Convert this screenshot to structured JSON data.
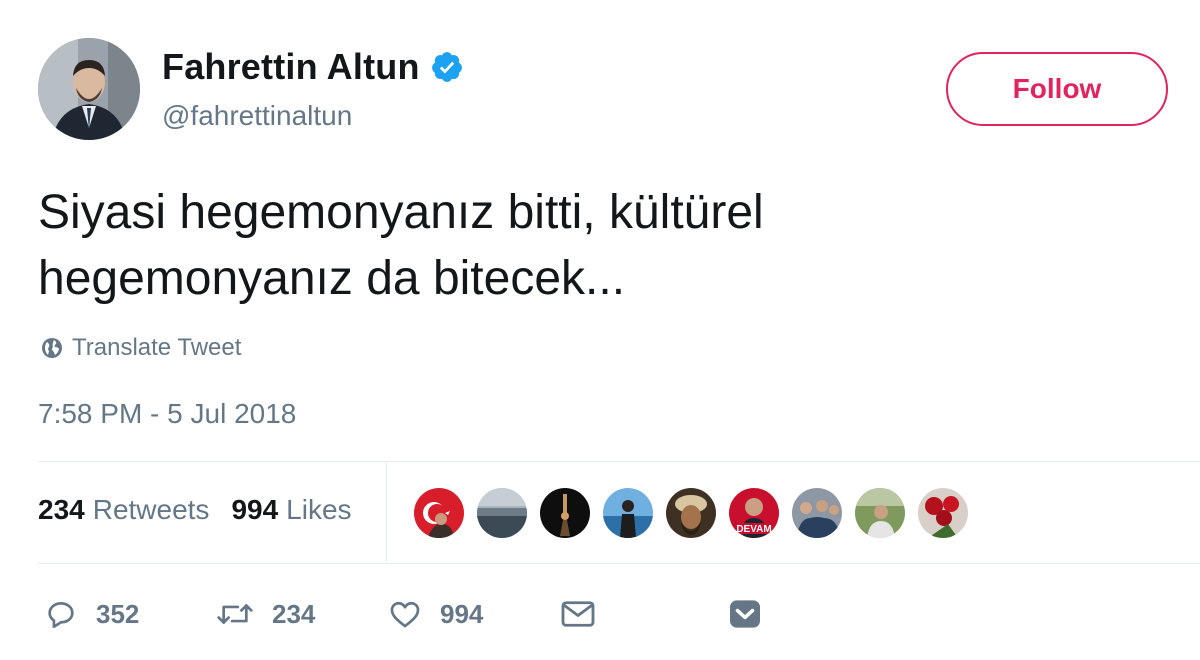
{
  "author": {
    "display_name": "Fahrettin Altun",
    "handle": "@fahrettinaltun",
    "verified": true
  },
  "follow_button": {
    "label": "Follow"
  },
  "tweet": {
    "text_lines": [
      "Siyasi hegemonyanız bitti, kültürel",
      "hegemonyanız da bitecek..."
    ],
    "translate_label": "Translate Tweet",
    "timestamp": "7:58 PM - 5 Jul 2018"
  },
  "stats": {
    "retweets": {
      "count": "234",
      "label": "Retweets"
    },
    "likes": {
      "count": "994",
      "label": "Likes"
    }
  },
  "likers": [
    {
      "icon": "turkish-flag-avatar"
    },
    {
      "icon": "landscape-avatar"
    },
    {
      "icon": "dark-figure-avatar"
    },
    {
      "icon": "seaside-person-avatar"
    },
    {
      "icon": "turban-man-avatar"
    },
    {
      "icon": "devam-red-avatar",
      "text": "DEVAM"
    },
    {
      "icon": "group-photo-avatar"
    },
    {
      "icon": "outdoor-man-avatar"
    },
    {
      "icon": "red-roses-avatar"
    }
  ],
  "actions": {
    "reply_count": "352",
    "retweet_count": "234",
    "like_count": "994"
  },
  "colors": {
    "accent": "#e0245e",
    "verified_blue": "#1da1f2",
    "text_primary": "#14171a",
    "text_secondary": "#657786",
    "divider": "#e6ecf0"
  }
}
